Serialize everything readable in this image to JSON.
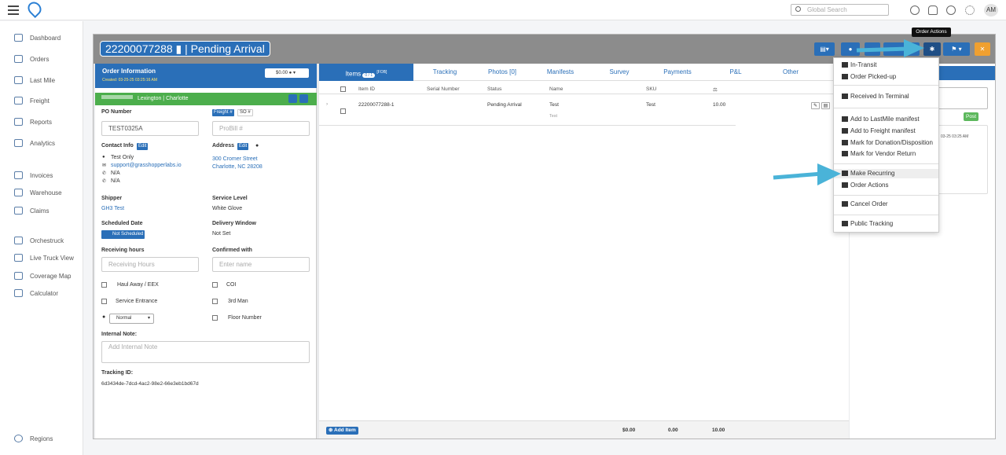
{
  "topbar": {
    "search_placeholder": "Global Search",
    "avatar": "AM",
    "icons": [
      "help-icon",
      "bell-icon",
      "history-icon",
      "gear-icon"
    ]
  },
  "sidebar": {
    "items": [
      {
        "label": "Dashboard",
        "icon": "dashboard-icon"
      },
      {
        "label": "Orders",
        "icon": "orders-icon"
      },
      {
        "label": "Last Mile",
        "icon": "last-mile-icon"
      },
      {
        "label": "Freight",
        "icon": "freight-icon"
      },
      {
        "label": "Reports",
        "icon": "reports-icon"
      },
      {
        "label": "Analytics",
        "icon": "analytics-icon"
      },
      {
        "label": "Invoices",
        "icon": "invoices-icon"
      },
      {
        "label": "Warehouse",
        "icon": "warehouse-icon"
      },
      {
        "label": "Claims",
        "icon": "claims-icon"
      },
      {
        "label": "Orchestruck",
        "icon": "orchestruck-icon"
      },
      {
        "label": "Live Truck View",
        "icon": "live-truck-icon"
      },
      {
        "label": "Coverage Map",
        "icon": "coverage-map-icon"
      },
      {
        "label": "Calculator",
        "icon": "calculator-icon"
      },
      {
        "label": "Regions",
        "icon": "regions-icon"
      }
    ]
  },
  "order": {
    "number": "22200077288",
    "status": "Pending Arrival",
    "title": "22200077288 ▮ | Pending Arrival"
  },
  "order_info": {
    "title": "Order Information",
    "created": "Created: 03-25-25 03:25:16 AM",
    "amount": "$0.00",
    "location": "Lexington | Charlotte",
    "po_label": "PO Number",
    "po_value": "TEST0325A",
    "freight_tag": "Freight #",
    "so_tag": "SO #",
    "probill_placeholder": "ProBill #",
    "contact_label": "Contact Info",
    "edit": "Edit",
    "contact_name": "Test Only",
    "contact_email": "support@grasshopperlabs.io",
    "phone1": "N/A",
    "phone2": "N/A",
    "address_label": "Address",
    "address_line1": "300 Cromer Street",
    "address_line2": "Charlotte, NC 28208",
    "shipper_label": "Shipper",
    "shipper_value": "GH3 Test",
    "service_label": "Service Level",
    "service_value": "White Glove",
    "sched_label": "Scheduled Date",
    "sched_value": "Not Scheduled",
    "window_label": "Delivery Window",
    "window_value": "Not Set",
    "recv_label": "Receiving hours",
    "recv_placeholder": "Receiving Hours",
    "confirmed_label": "Confirmed with",
    "confirmed_placeholder": "Enter name",
    "haul_away": "Haul Away / EEX",
    "coi": "COI",
    "service_entrance": "Service Entrance",
    "third_man": "3rd Man",
    "priority": "Normal",
    "floor_number": "Floor Number",
    "internal_note_label": "Internal Note:",
    "internal_note_placeholder": "Add Internal Note",
    "tracking_label": "Tracking ID:",
    "tracking_value": "6d3434de-7dcd-4ac2-98e2-66e3eb1bd67d"
  },
  "tabs": [
    {
      "label": "Items"
    },
    {
      "label": "Tracking"
    },
    {
      "label": "Photos [0]"
    },
    {
      "label": "Manifests"
    },
    {
      "label": "Survey"
    },
    {
      "label": "Payments"
    },
    {
      "label": "P&L"
    },
    {
      "label": "Other"
    }
  ],
  "items_badge": "0 / 1",
  "items_fob": "[FOB]",
  "table": {
    "columns": [
      "Item ID",
      "Serial Number",
      "Status",
      "Name",
      "SKU",
      "⚖"
    ],
    "rows": [
      {
        "item_id": "22200077288-1",
        "serial": "",
        "status": "Pending Arrival",
        "name": "Test",
        "name2": "Test",
        "sku": "Test",
        "weight": "10.00"
      }
    ]
  },
  "footer": {
    "add_item": "Add Item",
    "total_amount": "$0.00",
    "total_count": "0.00",
    "total_weight": "10.00"
  },
  "right_panel": {
    "post": "Post",
    "timestamp": "03-25 03:25 AM"
  },
  "tooltip": "Order Actions",
  "dropdown": {
    "group1": [
      "In-Transit",
      "Order Picked-up"
    ],
    "group2": [
      "Received In Terminal"
    ],
    "group3": [
      "Add to LastMile manifest",
      "Add to Freight manifest",
      "Mark for Donation/Disposition",
      "Mark for Vendor Return"
    ],
    "group4": [
      "Make Recurring",
      "Order Actions"
    ],
    "group5": [
      "Cancel Order"
    ],
    "group6": [
      "Public Tracking"
    ]
  },
  "colors": {
    "primary": "#2a6fb8",
    "success": "#4cae4c",
    "warning": "#f0a030",
    "arrow": "#4ab3d8"
  }
}
